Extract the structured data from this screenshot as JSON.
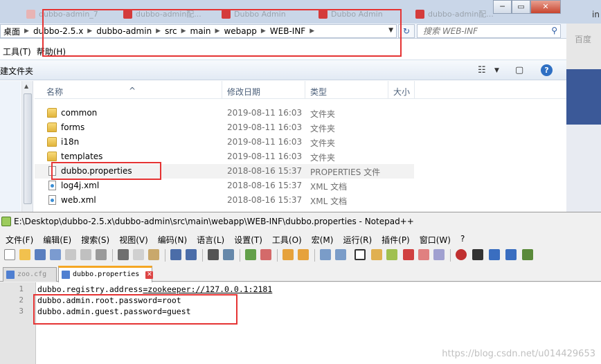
{
  "browser_tabs": [
    {
      "label": "dubbo-admin_7"
    },
    {
      "label": "dubbo-admin配..."
    },
    {
      "label": "Dubbo Admin"
    },
    {
      "label": "Dubbo Admin"
    },
    {
      "label": "dubbo-admin配..."
    }
  ],
  "browser_right": {
    "text": "in",
    "baidu": "百度"
  },
  "explorer": {
    "breadcrumbs": [
      "桌面",
      "dubbo-2.5.x",
      "dubbo-admin",
      "src",
      "main",
      "webapp",
      "WEB-INF"
    ],
    "search_placeholder": "搜索 WEB-INF",
    "menu": [
      "工具(T)",
      "帮助(H)"
    ],
    "toolbar_new_folder": "建文件夹",
    "columns": {
      "name": "名称",
      "date": "修改日期",
      "type": "类型",
      "size": "大小"
    },
    "files": [
      {
        "name": "common",
        "date": "2019-08-11 16:03",
        "type": "文件夹",
        "kind": "folder"
      },
      {
        "name": "forms",
        "date": "2019-08-11 16:03",
        "type": "文件夹",
        "kind": "folder"
      },
      {
        "name": "i18n",
        "date": "2019-08-11 16:03",
        "type": "文件夹",
        "kind": "folder"
      },
      {
        "name": "templates",
        "date": "2019-08-11 16:03",
        "type": "文件夹",
        "kind": "folder"
      },
      {
        "name": "dubbo.properties",
        "date": "2018-08-16 15:37",
        "type": "PROPERTIES 文件",
        "kind": "file"
      },
      {
        "name": "log4j.xml",
        "date": "2018-08-16 15:37",
        "type": "XML 文档",
        "kind": "xml"
      },
      {
        "name": "web.xml",
        "date": "2018-08-16 15:37",
        "type": "XML 文档",
        "kind": "xml"
      }
    ]
  },
  "notepad": {
    "title": "E:\\Desktop\\dubbo-2.5.x\\dubbo-admin\\src\\main\\webapp\\WEB-INF\\dubbo.properties - Notepad++",
    "menu": [
      "文件(F)",
      "编辑(E)",
      "搜索(S)",
      "视图(V)",
      "编码(N)",
      "语言(L)",
      "设置(T)",
      "工具(O)",
      "宏(M)",
      "运行(R)",
      "插件(P)",
      "窗口(W)",
      "?"
    ],
    "tabs": [
      {
        "label": "zoo.cfg",
        "active": false
      },
      {
        "label": "dubbo.properties",
        "active": true
      }
    ],
    "lines": [
      {
        "num": "1",
        "key": "dubbo.registry.address",
        "value": "zookeeper://127.0.0.1:2181"
      },
      {
        "num": "2",
        "key": "dubbo.admin.root.password",
        "value": "root"
      },
      {
        "num": "3",
        "key": "dubbo.admin.guest.password",
        "value": "guest"
      }
    ]
  },
  "watermark": "https://blog.csdn.net/u014429653"
}
